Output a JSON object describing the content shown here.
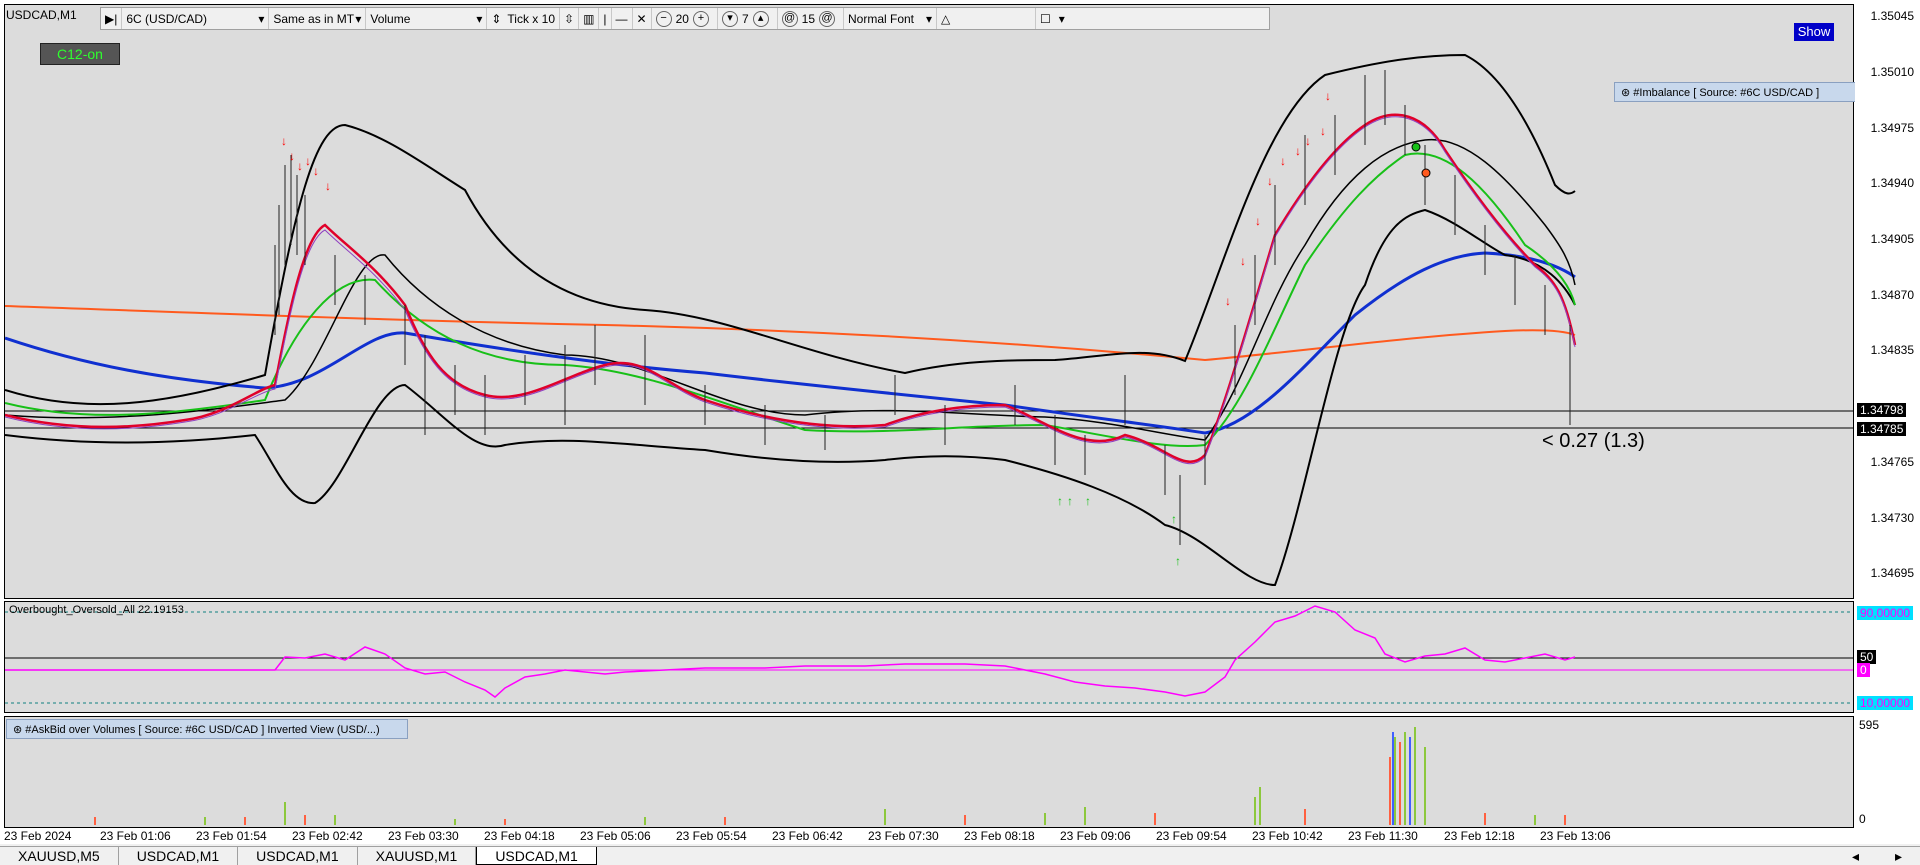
{
  "window": {
    "title": "USDCAD,M1"
  },
  "toolbar": {
    "symbol_select": "6C (USD/CAD)",
    "mode_select": "Same as in MT",
    "type_select": "Volume",
    "tick_label": "Tick x 10",
    "value_20": "20",
    "value_7": "7",
    "value_15": "15",
    "font_select": "Normal Font"
  },
  "buttons": {
    "c12": "C12-on",
    "show": "Show"
  },
  "imbalance_tag": "#Imbalance [ Source: #6C USD/CAD ]",
  "oscillator": {
    "label": "Overbought_Oversold_All 22.19153",
    "upper": "90,00000",
    "mid": "50",
    "lower": "10,00000",
    "mid_marker": "0"
  },
  "askbid_tag": "#AskBid over Volumes [ Source: #6C USD/CAD ] Inverted View (USD/...)",
  "volume_axis": {
    "top": "595",
    "bottom": "0"
  },
  "annotation": "< 0.27 (1.3)",
  "price_axis": {
    "labels": [
      "1.35045",
      "1.35010",
      "1.34975",
      "1.34940",
      "1.34905",
      "1.34870",
      "1.34835",
      "1.34765",
      "1.34730",
      "1.34695"
    ],
    "badges": [
      "1.34798",
      "1.34785"
    ]
  },
  "time_axis": [
    "23 Feb 2024",
    "23 Feb 01:06",
    "23 Feb 01:54",
    "23 Feb 02:42",
    "23 Feb 03:30",
    "23 Feb 04:18",
    "23 Feb 05:06",
    "23 Feb 05:54",
    "23 Feb 06:42",
    "23 Feb 07:30",
    "23 Feb 08:18",
    "23 Feb 09:06",
    "23 Feb 09:54",
    "23 Feb 10:42",
    "23 Feb 11:30",
    "23 Feb 12:18",
    "23 Feb 13:06"
  ],
  "tabs": [
    "XAUUSD,M5",
    "USDCAD,M1",
    "USDCAD,M1",
    "XAUUSD,M1",
    "USDCAD,M1"
  ],
  "active_tab": 4,
  "colors": {
    "ma_blue": "#1030d0",
    "ma_orange": "#ff5a1e",
    "ma_red": "#e0002a",
    "ma_green": "#18c018",
    "osc": "#ff00ff",
    "bands": "#000000"
  }
}
